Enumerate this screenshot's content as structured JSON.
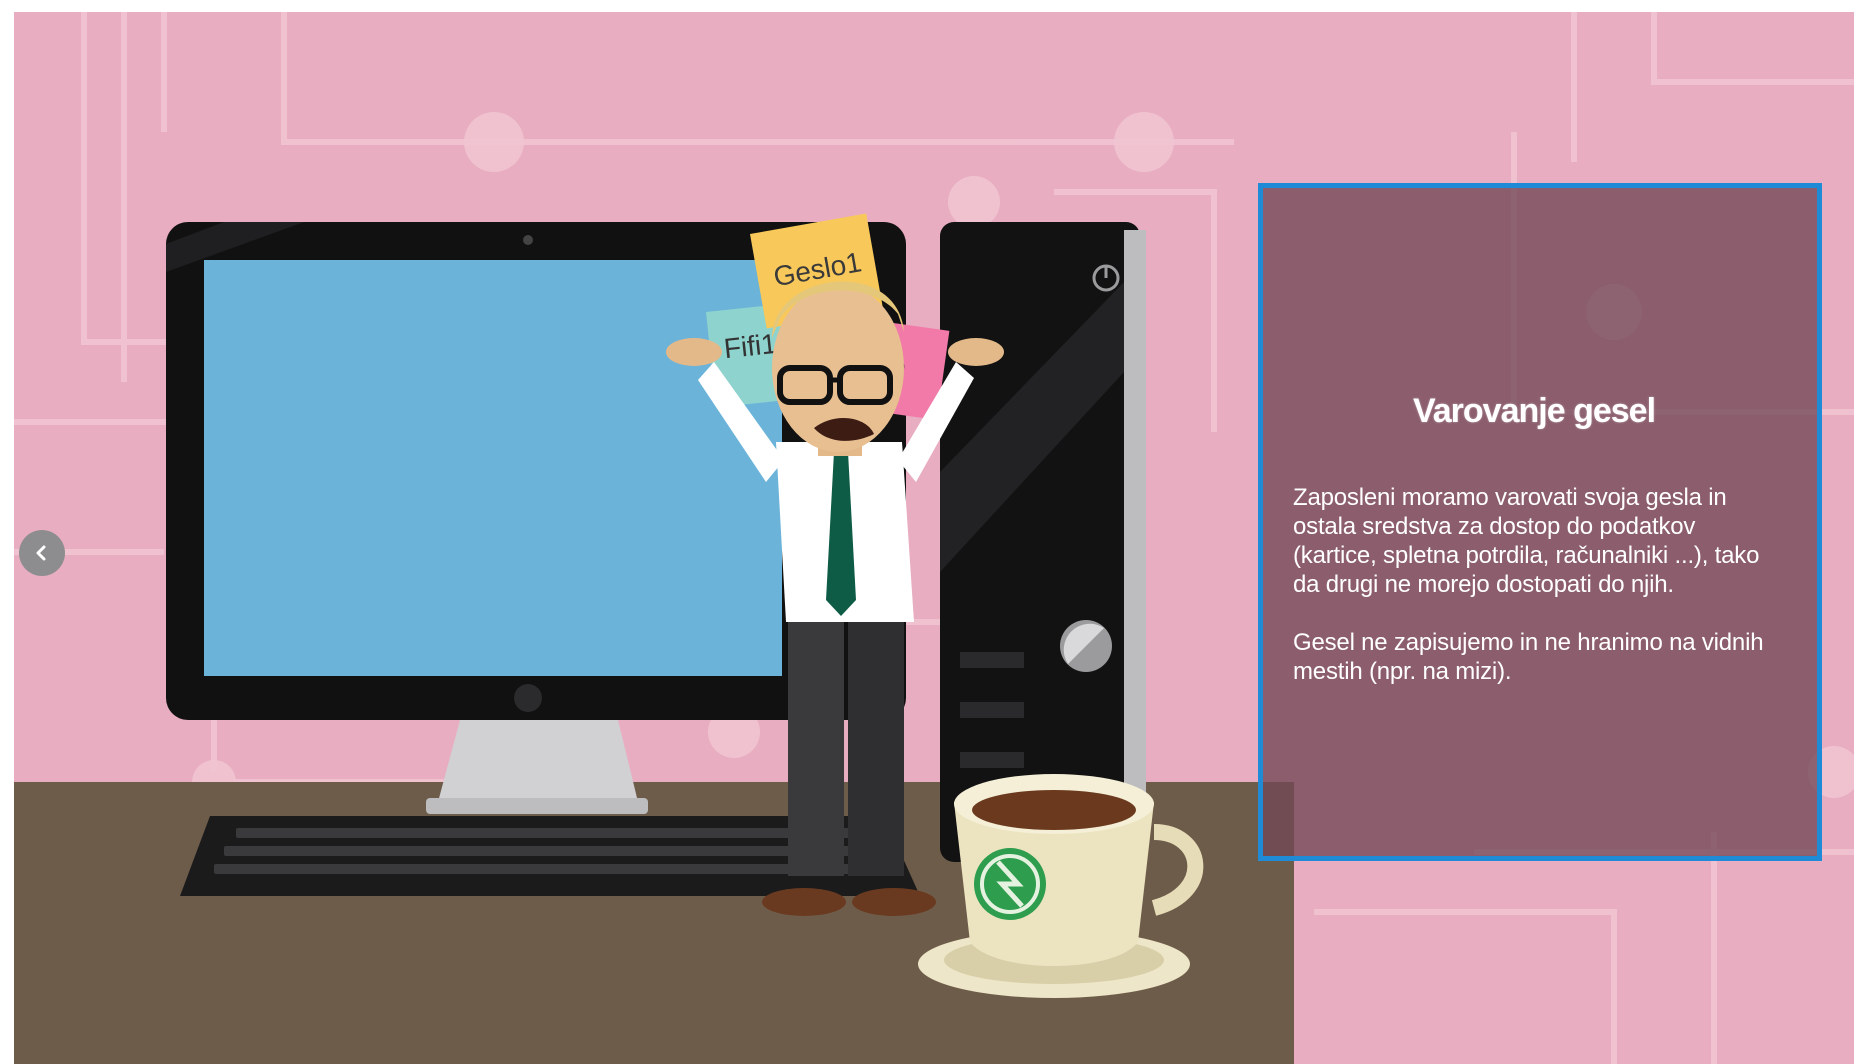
{
  "slide": {
    "panel": {
      "title": "Varovanje gesel",
      "paragraphs": [
        "Zaposleni moramo varovati svoja gesla in ostala sredstva za dostop do podatkov (kartice, spletna potrdila, računalniki ...), tako da drugi ne morejo dostopati do njih.",
        "Gesel ne zapisujemo in ne hranimo na vidnih mestih (npr. na mizi)."
      ]
    },
    "illustration": {
      "sticky_notes": [
        "Geslo1",
        "Fifi1",
        "%"
      ]
    }
  },
  "nav": {
    "prev_icon": "chevron-left-icon"
  },
  "colors": {
    "background": "#e8adc0",
    "desk": "#6e5c4a",
    "screen": "#6bb3d8",
    "panel_border": "#1f8ad6",
    "panel_fill": "#8a5a6d"
  }
}
